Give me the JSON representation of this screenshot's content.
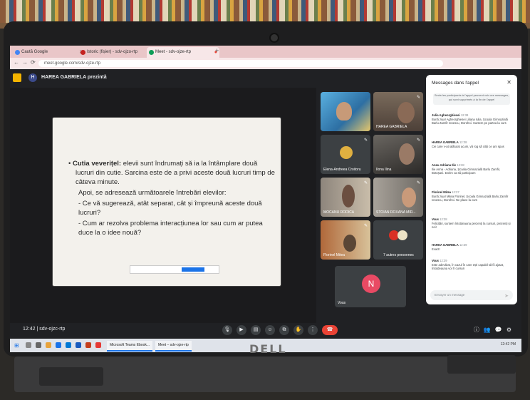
{
  "browser": {
    "tabs": [
      {
        "label": "Caută Google"
      },
      {
        "label": "Istoric (fișier) - sdv-ojzo-rtp"
      },
      {
        "label": "Meet - sdv-ojze-rtp",
        "active": true
      }
    ],
    "url": "meet.google.com/sdv-ojze-rtp"
  },
  "meet": {
    "presenter_initial": "H",
    "presenter_text": "HAREA GABRIELA prezintă",
    "meeting_time": "12:42",
    "meeting_code": "sdv-ojzc-rtp"
  },
  "slide": {
    "bullet_title": "Cutia veverițel:",
    "bullet_text": " elevii sunt îndrumați să ia la întâmplare două lucruri din cutie. Sarcina este de a privi aceste două lucruri timp de câteva minute.",
    "line2": "Apoi, se adresează următoarele întrebări elevilor:",
    "q1": "- Ce vă sugerează, atât separat, cât și împreună aceste două lucruri?",
    "q2": "- Cum ar rezolva problema interacțiunea lor sau cum ar putea duce la o idee nouă?"
  },
  "participants": [
    {
      "name": "",
      "color": "#4e8fb8"
    },
    {
      "name": "HAREA GABRIELA",
      "color": "#6b5a4a"
    },
    {
      "name": "Elena-Andreea Croitoru",
      "color": "#3c4043"
    },
    {
      "name": "Ilona Ilina",
      "color": "#4a4844"
    },
    {
      "name": "MOCANU RODICA",
      "color": "#5e5a56"
    },
    {
      "name": "STOIAN ROXANA MIR...",
      "color": "#6e6a64"
    },
    {
      "name": "Florinel Mitea",
      "color": "#8a6a4a"
    },
    {
      "name": "7 autres personnes",
      "color": "#3c4043"
    },
    {
      "name": "Vous",
      "initial": "N",
      "color": "#3c4043"
    }
  ],
  "chat": {
    "title": "Messages dans l'appel",
    "note": "Seuls les participants à l'appel peuvent voir ces messages, qui sont supprimés à la fin de l'appel",
    "messages": [
      {
        "who": "Julia Agheorghiesei",
        "time": "12:38",
        "text": "Bună ziua! Agheorghiesei Liliana Iulia, Școala Gimnazială Barlu Zamfir Ionescu, Dorohoi. Suntem pe partea la curs"
      },
      {
        "who": "HAREA GABRIELA",
        "time": "12:38",
        "text": "Cei care v-ati alăturat acum, vă rog să citiți ce am spus"
      },
      {
        "who": "Aneu Adriana Ilie",
        "time": "12:38",
        "text": "Ilie Anna - Adriana, Școala Gimnazială Barlu Zamfir, Botoșani. Dorim ca să participam"
      },
      {
        "who": "Florinel Mitea",
        "time": "12:37",
        "text": "Bună ziua! Mitea Florinel, Școala Gimnazială Barlu Zamfir Ionescu, Dorohoi. Ne place la curs"
      },
      {
        "who": "Vous",
        "time": "12:38",
        "text": "Felicitări, suntem întotdeauna prezenți la cursuri, prezenți și noi!"
      },
      {
        "who": "HAREA GABRIELA",
        "time": "12:39",
        "text": "Exact!"
      },
      {
        "who": "Vous",
        "time": "12:39",
        "text": "Este adevărat, în cazul în care ești capabil să fii ajutat, întotdeauna vor fi cursuri"
      }
    ],
    "input_placeholder": "Envoyer un message"
  },
  "taskbar": {
    "apps": [
      "Microsoft Teams Ebook...",
      "Meet – sdv-ojze-rtp"
    ],
    "clock": "12:42 PM"
  },
  "brand": "DELL"
}
